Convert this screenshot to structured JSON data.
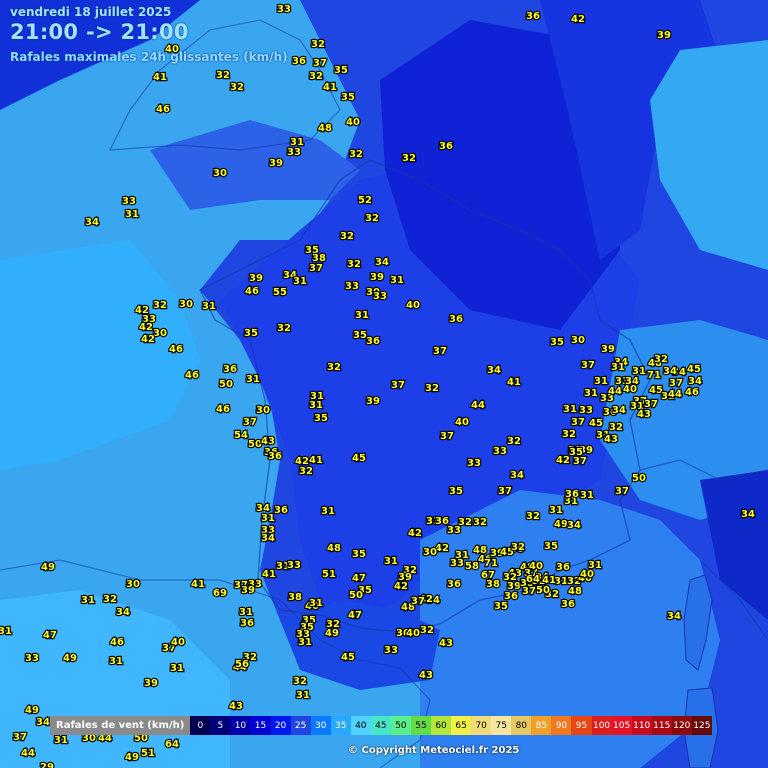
{
  "header": {
    "date": "vendredi 18 juillet 2025",
    "time": "21:00 -> 21:00",
    "subtitle": "Rafales maximales 24h glissantes (km/h)"
  },
  "legend": {
    "label": "Rafales de vent (km/h)",
    "steps": [
      {
        "v": "0",
        "c": "#000050",
        "t": "#ffffff"
      },
      {
        "v": "5",
        "c": "#000078",
        "t": "#ffffff"
      },
      {
        "v": "10",
        "c": "#0000a8",
        "t": "#ffffff"
      },
      {
        "v": "15",
        "c": "#0000d0",
        "t": "#ffffff"
      },
      {
        "v": "20",
        "c": "#0018f0",
        "t": "#ffffff"
      },
      {
        "v": "25",
        "c": "#1f46e0",
        "t": "#ffffff"
      },
      {
        "v": "30",
        "c": "#0a78ff",
        "t": "#ffffff"
      },
      {
        "v": "35",
        "c": "#28a8ff",
        "t": "#ffffff"
      },
      {
        "v": "40",
        "c": "#50d2ff",
        "t": "#000000"
      },
      {
        "v": "45",
        "c": "#46e6c8",
        "t": "#000000"
      },
      {
        "v": "50",
        "c": "#5aee8c",
        "t": "#000000"
      },
      {
        "v": "55",
        "c": "#64dc46",
        "t": "#000000"
      },
      {
        "v": "60",
        "c": "#b4e63c",
        "t": "#000000"
      },
      {
        "v": "65",
        "c": "#f0f046",
        "t": "#000000"
      },
      {
        "v": "70",
        "c": "#f0dc78",
        "t": "#000000"
      },
      {
        "v": "75",
        "c": "#f5e6a0",
        "t": "#000000"
      },
      {
        "v": "80",
        "c": "#e6c864",
        "t": "#000000"
      },
      {
        "v": "85",
        "c": "#f0a028",
        "t": "#ffffff"
      },
      {
        "v": "90",
        "c": "#f07820",
        "t": "#ffffff"
      },
      {
        "v": "95",
        "c": "#e64614",
        "t": "#ffffff"
      },
      {
        "v": "100",
        "c": "#dc1e1e",
        "t": "#ffffff"
      },
      {
        "v": "105",
        "c": "#e61428",
        "t": "#ffffff"
      },
      {
        "v": "110",
        "c": "#c80a1e",
        "t": "#ffffff"
      },
      {
        "v": "115",
        "c": "#aa0a14",
        "t": "#ffffff"
      },
      {
        "v": "120",
        "c": "#8c0a0a",
        "t": "#ffffff"
      },
      {
        "v": "125",
        "c": "#640a0a",
        "t": "#ffffff"
      }
    ]
  },
  "copyright": "© Copyright Meteociel.fr 2025",
  "stations": [
    {
      "v": "33"
    },
    {
      "v": "36"
    },
    {
      "v": "42"
    },
    {
      "v": "39"
    },
    {
      "v": "32"
    },
    {
      "v": "40"
    },
    {
      "v": "36"
    },
    {
      "v": "37"
    },
    {
      "v": "32"
    },
    {
      "v": "35"
    },
    {
      "v": "41"
    },
    {
      "v": "32"
    },
    {
      "v": "46"
    },
    {
      "v": "32"
    },
    {
      "v": "41"
    },
    {
      "v": "35"
    },
    {
      "v": "40"
    },
    {
      "v": "48"
    },
    {
      "v": "31"
    },
    {
      "v": "33"
    },
    {
      "v": "32"
    },
    {
      "v": "39"
    },
    {
      "v": "36"
    },
    {
      "v": "32"
    },
    {
      "v": "30"
    },
    {
      "v": "33"
    },
    {
      "v": "34"
    },
    {
      "v": "31"
    },
    {
      "v": "52"
    },
    {
      "v": "32"
    },
    {
      "v": "32"
    },
    {
      "v": "35"
    },
    {
      "v": "38"
    },
    {
      "v": "37"
    },
    {
      "v": "32"
    },
    {
      "v": "34"
    },
    {
      "v": "39"
    },
    {
      "v": "34"
    },
    {
      "v": "31"
    },
    {
      "v": "39"
    },
    {
      "v": "46"
    },
    {
      "v": "55"
    },
    {
      "v": "33"
    },
    {
      "v": "30"
    },
    {
      "v": "33"
    },
    {
      "v": "31"
    },
    {
      "v": "42"
    },
    {
      "v": "32"
    },
    {
      "v": "30"
    },
    {
      "v": "31"
    },
    {
      "v": "40"
    },
    {
      "v": "33"
    },
    {
      "v": "42"
    },
    {
      "v": "30"
    },
    {
      "v": "42"
    },
    {
      "v": "35"
    },
    {
      "v": "32"
    },
    {
      "v": "31"
    },
    {
      "v": "35"
    },
    {
      "v": "36"
    },
    {
      "v": "36"
    },
    {
      "v": "46"
    },
    {
      "v": "46"
    },
    {
      "v": "50"
    },
    {
      "v": "36"
    },
    {
      "v": "31"
    },
    {
      "v": "32"
    },
    {
      "v": "37"
    },
    {
      "v": "37"
    },
    {
      "v": "32"
    },
    {
      "v": "31"
    },
    {
      "v": "31"
    },
    {
      "v": "35"
    },
    {
      "v": "39"
    },
    {
      "v": "46"
    },
    {
      "v": "30"
    },
    {
      "v": "37"
    },
    {
      "v": "54"
    },
    {
      "v": "50"
    },
    {
      "v": "36"
    },
    {
      "v": "43"
    },
    {
      "v": "36"
    },
    {
      "v": "42"
    },
    {
      "v": "41"
    },
    {
      "v": "32"
    },
    {
      "v": "45"
    },
    {
      "v": "34"
    },
    {
      "v": "41"
    },
    {
      "v": "44"
    },
    {
      "v": "40"
    },
    {
      "v": "37"
    },
    {
      "v": "33"
    },
    {
      "v": "33"
    },
    {
      "v": "32"
    },
    {
      "v": "34"
    },
    {
      "v": "35"
    },
    {
      "v": "37"
    },
    {
      "v": "34"
    },
    {
      "v": "31"
    },
    {
      "v": "33"
    },
    {
      "v": "34"
    },
    {
      "v": "36"
    },
    {
      "v": "31"
    },
    {
      "v": "33"
    },
    {
      "v": "36"
    },
    {
      "v": "32"
    },
    {
      "v": "32"
    },
    {
      "v": "33"
    },
    {
      "v": "32"
    },
    {
      "v": "31"
    },
    {
      "v": "49"
    },
    {
      "v": "34"
    },
    {
      "v": "31"
    },
    {
      "v": "36"
    },
    {
      "v": "31"
    },
    {
      "v": "37"
    },
    {
      "v": "42"
    },
    {
      "v": "31"
    },
    {
      "v": "37"
    },
    {
      "v": "39"
    },
    {
      "v": "35"
    },
    {
      "v": "30"
    },
    {
      "v": "37"
    },
    {
      "v": "39"
    },
    {
      "v": "34"
    },
    {
      "v": "31"
    },
    {
      "v": "31"
    },
    {
      "v": "33"
    },
    {
      "v": "33"
    },
    {
      "v": "37"
    },
    {
      "v": "34"
    },
    {
      "v": "32"
    },
    {
      "v": "36"
    },
    {
      "v": "37"
    },
    {
      "v": "45"
    },
    {
      "v": "31"
    },
    {
      "v": "35"
    },
    {
      "v": "32"
    },
    {
      "v": "44"
    },
    {
      "v": "40"
    },
    {
      "v": "31"
    },
    {
      "v": "37"
    },
    {
      "v": "33"
    },
    {
      "v": "31"
    },
    {
      "v": "31"
    },
    {
      "v": "34"
    },
    {
      "v": "43"
    },
    {
      "v": "45"
    },
    {
      "v": "48"
    },
    {
      "v": "34"
    },
    {
      "v": "37"
    },
    {
      "v": "32"
    },
    {
      "v": "31"
    },
    {
      "v": "45"
    },
    {
      "v": "34"
    },
    {
      "v": "46"
    },
    {
      "v": "44"
    },
    {
      "v": "71"
    },
    {
      "v": "31"
    },
    {
      "v": "34"
    },
    {
      "v": "43"
    },
    {
      "v": "50"
    },
    {
      "v": "34"
    },
    {
      "v": "48"
    },
    {
      "v": "31"
    },
    {
      "v": "58"
    },
    {
      "v": "36"
    },
    {
      "v": "46"
    },
    {
      "v": "38"
    },
    {
      "v": "67"
    },
    {
      "v": "71"
    },
    {
      "v": "68"
    },
    {
      "v": "43"
    },
    {
      "v": "48"
    },
    {
      "v": "37"
    },
    {
      "v": "32"
    },
    {
      "v": "39"
    },
    {
      "v": "35"
    },
    {
      "v": "32"
    },
    {
      "v": "37"
    },
    {
      "v": "34"
    },
    {
      "v": "31"
    },
    {
      "v": "32"
    },
    {
      "v": "40"
    },
    {
      "v": "36"
    },
    {
      "v": "48"
    },
    {
      "v": "36"
    },
    {
      "v": "32"
    },
    {
      "v": "41"
    },
    {
      "v": "50"
    },
    {
      "v": "64"
    },
    {
      "v": "40"
    },
    {
      "v": "39"
    },
    {
      "v": "45"
    },
    {
      "v": "32"
    },
    {
      "v": "35"
    },
    {
      "v": "31"
    },
    {
      "v": "40"
    },
    {
      "v": "35"
    },
    {
      "v": "36"
    },
    {
      "v": "33"
    },
    {
      "v": "42"
    },
    {
      "v": "30"
    },
    {
      "v": "42"
    },
    {
      "v": "35"
    },
    {
      "v": "31"
    },
    {
      "v": "32"
    },
    {
      "v": "39"
    },
    {
      "v": "47"
    },
    {
      "v": "35"
    },
    {
      "v": "42"
    },
    {
      "v": "34"
    },
    {
      "v": "42"
    },
    {
      "v": "47"
    },
    {
      "v": "48"
    },
    {
      "v": "37"
    },
    {
      "v": "30"
    },
    {
      "v": "40"
    },
    {
      "v": "32"
    },
    {
      "v": "33"
    },
    {
      "v": "43"
    },
    {
      "v": "49"
    },
    {
      "v": "32"
    },
    {
      "v": "40"
    },
    {
      "v": "38"
    },
    {
      "v": "31"
    },
    {
      "v": "35"
    },
    {
      "v": "35"
    },
    {
      "v": "33"
    },
    {
      "v": "31"
    },
    {
      "v": "48"
    },
    {
      "v": "51"
    },
    {
      "v": "50"
    },
    {
      "v": "31"
    },
    {
      "v": "36"
    },
    {
      "v": "37"
    },
    {
      "v": "33"
    },
    {
      "v": "41"
    },
    {
      "v": "31"
    },
    {
      "v": "33"
    },
    {
      "v": "39"
    },
    {
      "v": "41"
    },
    {
      "v": "69"
    },
    {
      "v": "30"
    },
    {
      "v": "31"
    },
    {
      "v": "32"
    },
    {
      "v": "34"
    },
    {
      "v": "49"
    },
    {
      "v": "31"
    },
    {
      "v": "47"
    },
    {
      "v": "33"
    },
    {
      "v": "49"
    },
    {
      "v": "46"
    },
    {
      "v": "31"
    },
    {
      "v": "37"
    },
    {
      "v": "40"
    },
    {
      "v": "31"
    },
    {
      "v": "44"
    },
    {
      "v": "32"
    },
    {
      "v": "56"
    },
    {
      "v": "39"
    },
    {
      "v": "32"
    },
    {
      "v": "31"
    },
    {
      "v": "43"
    },
    {
      "v": "49"
    },
    {
      "v": "34"
    },
    {
      "v": "31"
    },
    {
      "v": "30"
    },
    {
      "v": "44"
    },
    {
      "v": "64"
    },
    {
      "v": "50"
    },
    {
      "v": "51"
    },
    {
      "v": "49"
    },
    {
      "v": "44"
    },
    {
      "v": "29"
    },
    {
      "v": "37"
    },
    {
      "v": "45"
    },
    {
      "v": "43"
    },
    {
      "v": "34"
    }
  ]
}
